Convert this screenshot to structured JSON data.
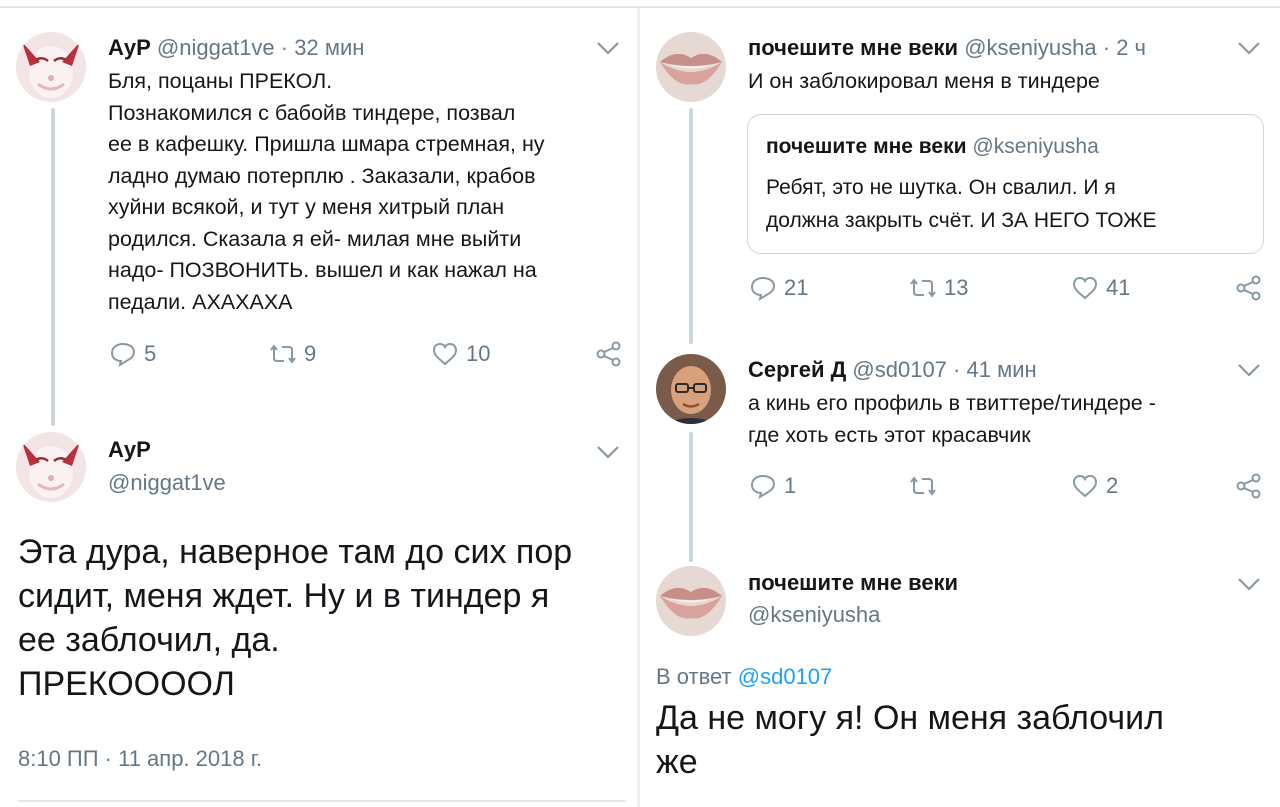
{
  "left": {
    "tweet1": {
      "name": "АуР",
      "handle": "@niggat1ve",
      "sep": "·",
      "time": "32 мин",
      "text_lines": [
        "Бля, поцаны ПРЕКОЛ.",
        "Познакомился  с бабойв тиндере, позвал",
        "ее в кафешку. Пришла шмара стремная, ну",
        "ладно думаю потерплю . Заказали, крабов",
        "хуйни  всякой, и тут у меня  хитрый план",
        "родился. Сказала я ей- милая мне выйти",
        "надо- ПОЗВОНИТЬ. вышел и как нажал на",
        "педали. АХАХАХА"
      ],
      "reply_count": "5",
      "retweet_count": "9",
      "like_count": "10",
      "avatar_icon": "anime-avatar-icon"
    },
    "tweet2": {
      "name": "АуР",
      "handle": "@niggat1ve",
      "text_lines": [
        "Эта дура, наверное там до сих пор",
        "сидит, меня ждет. Ну и в тиндер я",
        "ее заблочил, да.",
        "ПРЕКООООЛ"
      ],
      "timestamp": "8:10 ПП · 11 апр. 2018 г."
    }
  },
  "right": {
    "tweet1": {
      "name": "почешите мне веки",
      "handle": "@kseniyusha",
      "sep": "·",
      "time": "2 ч",
      "text": "И он заблокировал меня в тиндере",
      "quote": {
        "name": "почешите мне веки",
        "handle": "@kseniyusha",
        "text_lines": [
          "Ребят, это не шутка. Он свалил. И я",
          "должна закрыть счёт.  И ЗА НЕГО ТОЖЕ"
        ]
      },
      "reply_count": "21",
      "retweet_count": "13",
      "like_count": "41"
    },
    "tweet2": {
      "name": "Сергей Д",
      "handle": "@sd0107",
      "sep": "·",
      "time": "41 мин",
      "text_lines": [
        "а кинь его профиль в твиттере/тиндере -",
        "где хоть есть этот красавчик"
      ],
      "reply_count": "1",
      "retweet_count": "",
      "like_count": "2"
    },
    "tweet3": {
      "name": "почешите мне веки",
      "handle": "@kseniyusha",
      "reply_prefix": "В ответ",
      "reply_mention": "@sd0107",
      "text_lines": [
        "Да не могу я! Он меня заблочил",
        "же"
      ]
    }
  },
  "colors": {
    "text": "#14171a",
    "secondary": "#657786",
    "link": "#1da1f2",
    "border": "#ccd6dd"
  }
}
